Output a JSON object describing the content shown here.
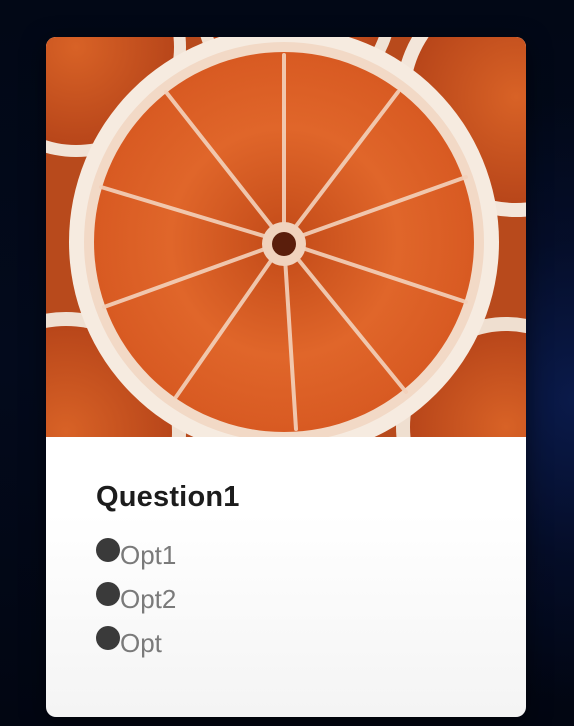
{
  "card": {
    "image_icon": "orange-slice-photo",
    "question": {
      "title": "Question1",
      "options": [
        {
          "label": "Opt1"
        },
        {
          "label": "Opt2"
        },
        {
          "label": "Opt"
        }
      ]
    }
  },
  "colors": {
    "background": "#030a1c",
    "card": "#ffffff",
    "orange": "#e0631f",
    "radio": "#3a3a3a",
    "title": "#1c1c1c",
    "option_text": "#7a7a7a"
  }
}
